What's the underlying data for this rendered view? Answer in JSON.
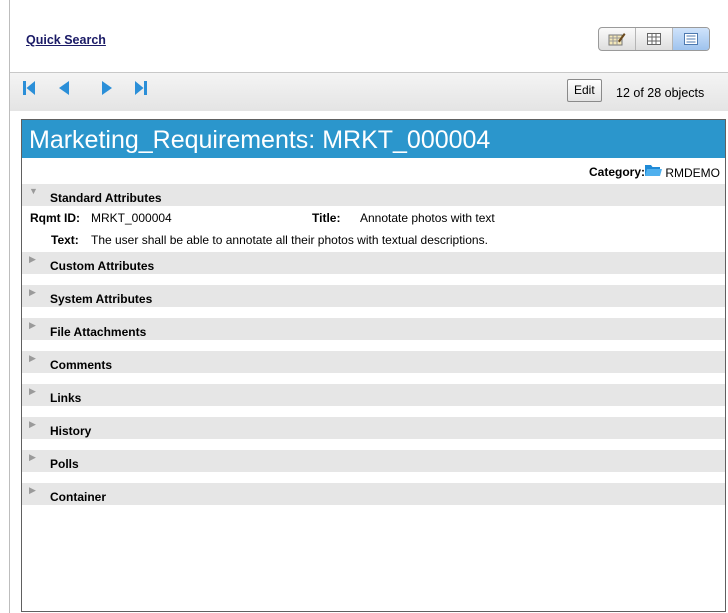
{
  "toolbar": {
    "quick_search_label": "Quick Search",
    "views": [
      {
        "name": "form-view",
        "active": false
      },
      {
        "name": "grid-view",
        "active": false
      },
      {
        "name": "list-view",
        "active": true
      }
    ]
  },
  "navbar": {
    "edit_label": "Edit",
    "object_count": "12 of 28 objects"
  },
  "record": {
    "title": "Marketing_Requirements: MRKT_000004",
    "category_label": "Category:",
    "category_value": "RMDEMO",
    "standard_attributes": {
      "section_label": "Standard Attributes",
      "rqmt_id_label": "Rqmt ID:",
      "rqmt_id_value": "MRKT_000004",
      "title_label": "Title:",
      "title_value": "Annotate photos with text",
      "text_label": "Text:",
      "text_value": "The user shall be able to annotate all their photos with textual descriptions."
    },
    "sections": [
      {
        "label": "Custom Attributes"
      },
      {
        "label": "System Attributes"
      },
      {
        "label": "File Attachments"
      },
      {
        "label": "Comments"
      },
      {
        "label": "Links"
      },
      {
        "label": "History"
      },
      {
        "label": "Polls"
      },
      {
        "label": "Container"
      }
    ]
  },
  "colors": {
    "title_bar": "#2b96cc",
    "section_bg": "#e6e6e6",
    "nav_icon": "#2b8fd8"
  }
}
